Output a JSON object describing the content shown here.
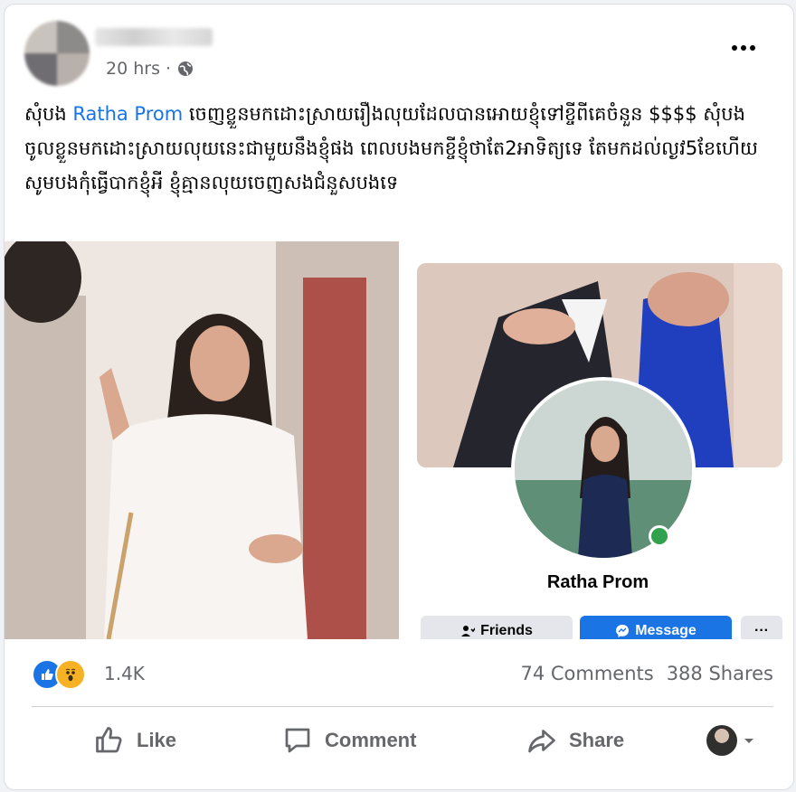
{
  "post": {
    "time": "20 hrs ·",
    "text_before": "សុំបង ",
    "tag": "Ratha Prom",
    "text_after": " ចេញខ្លួនមកដោះស្រាយរឿងលុយដែលបានអោយខ្ញុំទៅខ្ចីពីគេចំនួន $$$$ សុំបងចូលខ្លួនមកដោះស្រាយលុយនេះជាមួយនឹងខ្ញុំផង ពេលបងមកខ្ចីខ្ញុំថាតែ2អាទិត្យទេ តែមកដល់ល្ងវ5ខែហើយ សូមបងកុំធ្វើបាកខ្ញុំអី ខ្ញុំគ្មានលុយចេញសងជំនួសបងទេ"
  },
  "profile_card": {
    "name": "Ratha Prom",
    "friends_label": "Friends",
    "message_label": "Message",
    "more_label": "···"
  },
  "stats": {
    "reactions_count": "1.4K",
    "comments": "74 Comments",
    "shares": "388 Shares"
  },
  "actions": {
    "like": "Like",
    "comment": "Comment",
    "share": "Share"
  },
  "colors": {
    "accent": "#1b74e4",
    "wow": "#f7b125",
    "online": "#31a24c"
  }
}
